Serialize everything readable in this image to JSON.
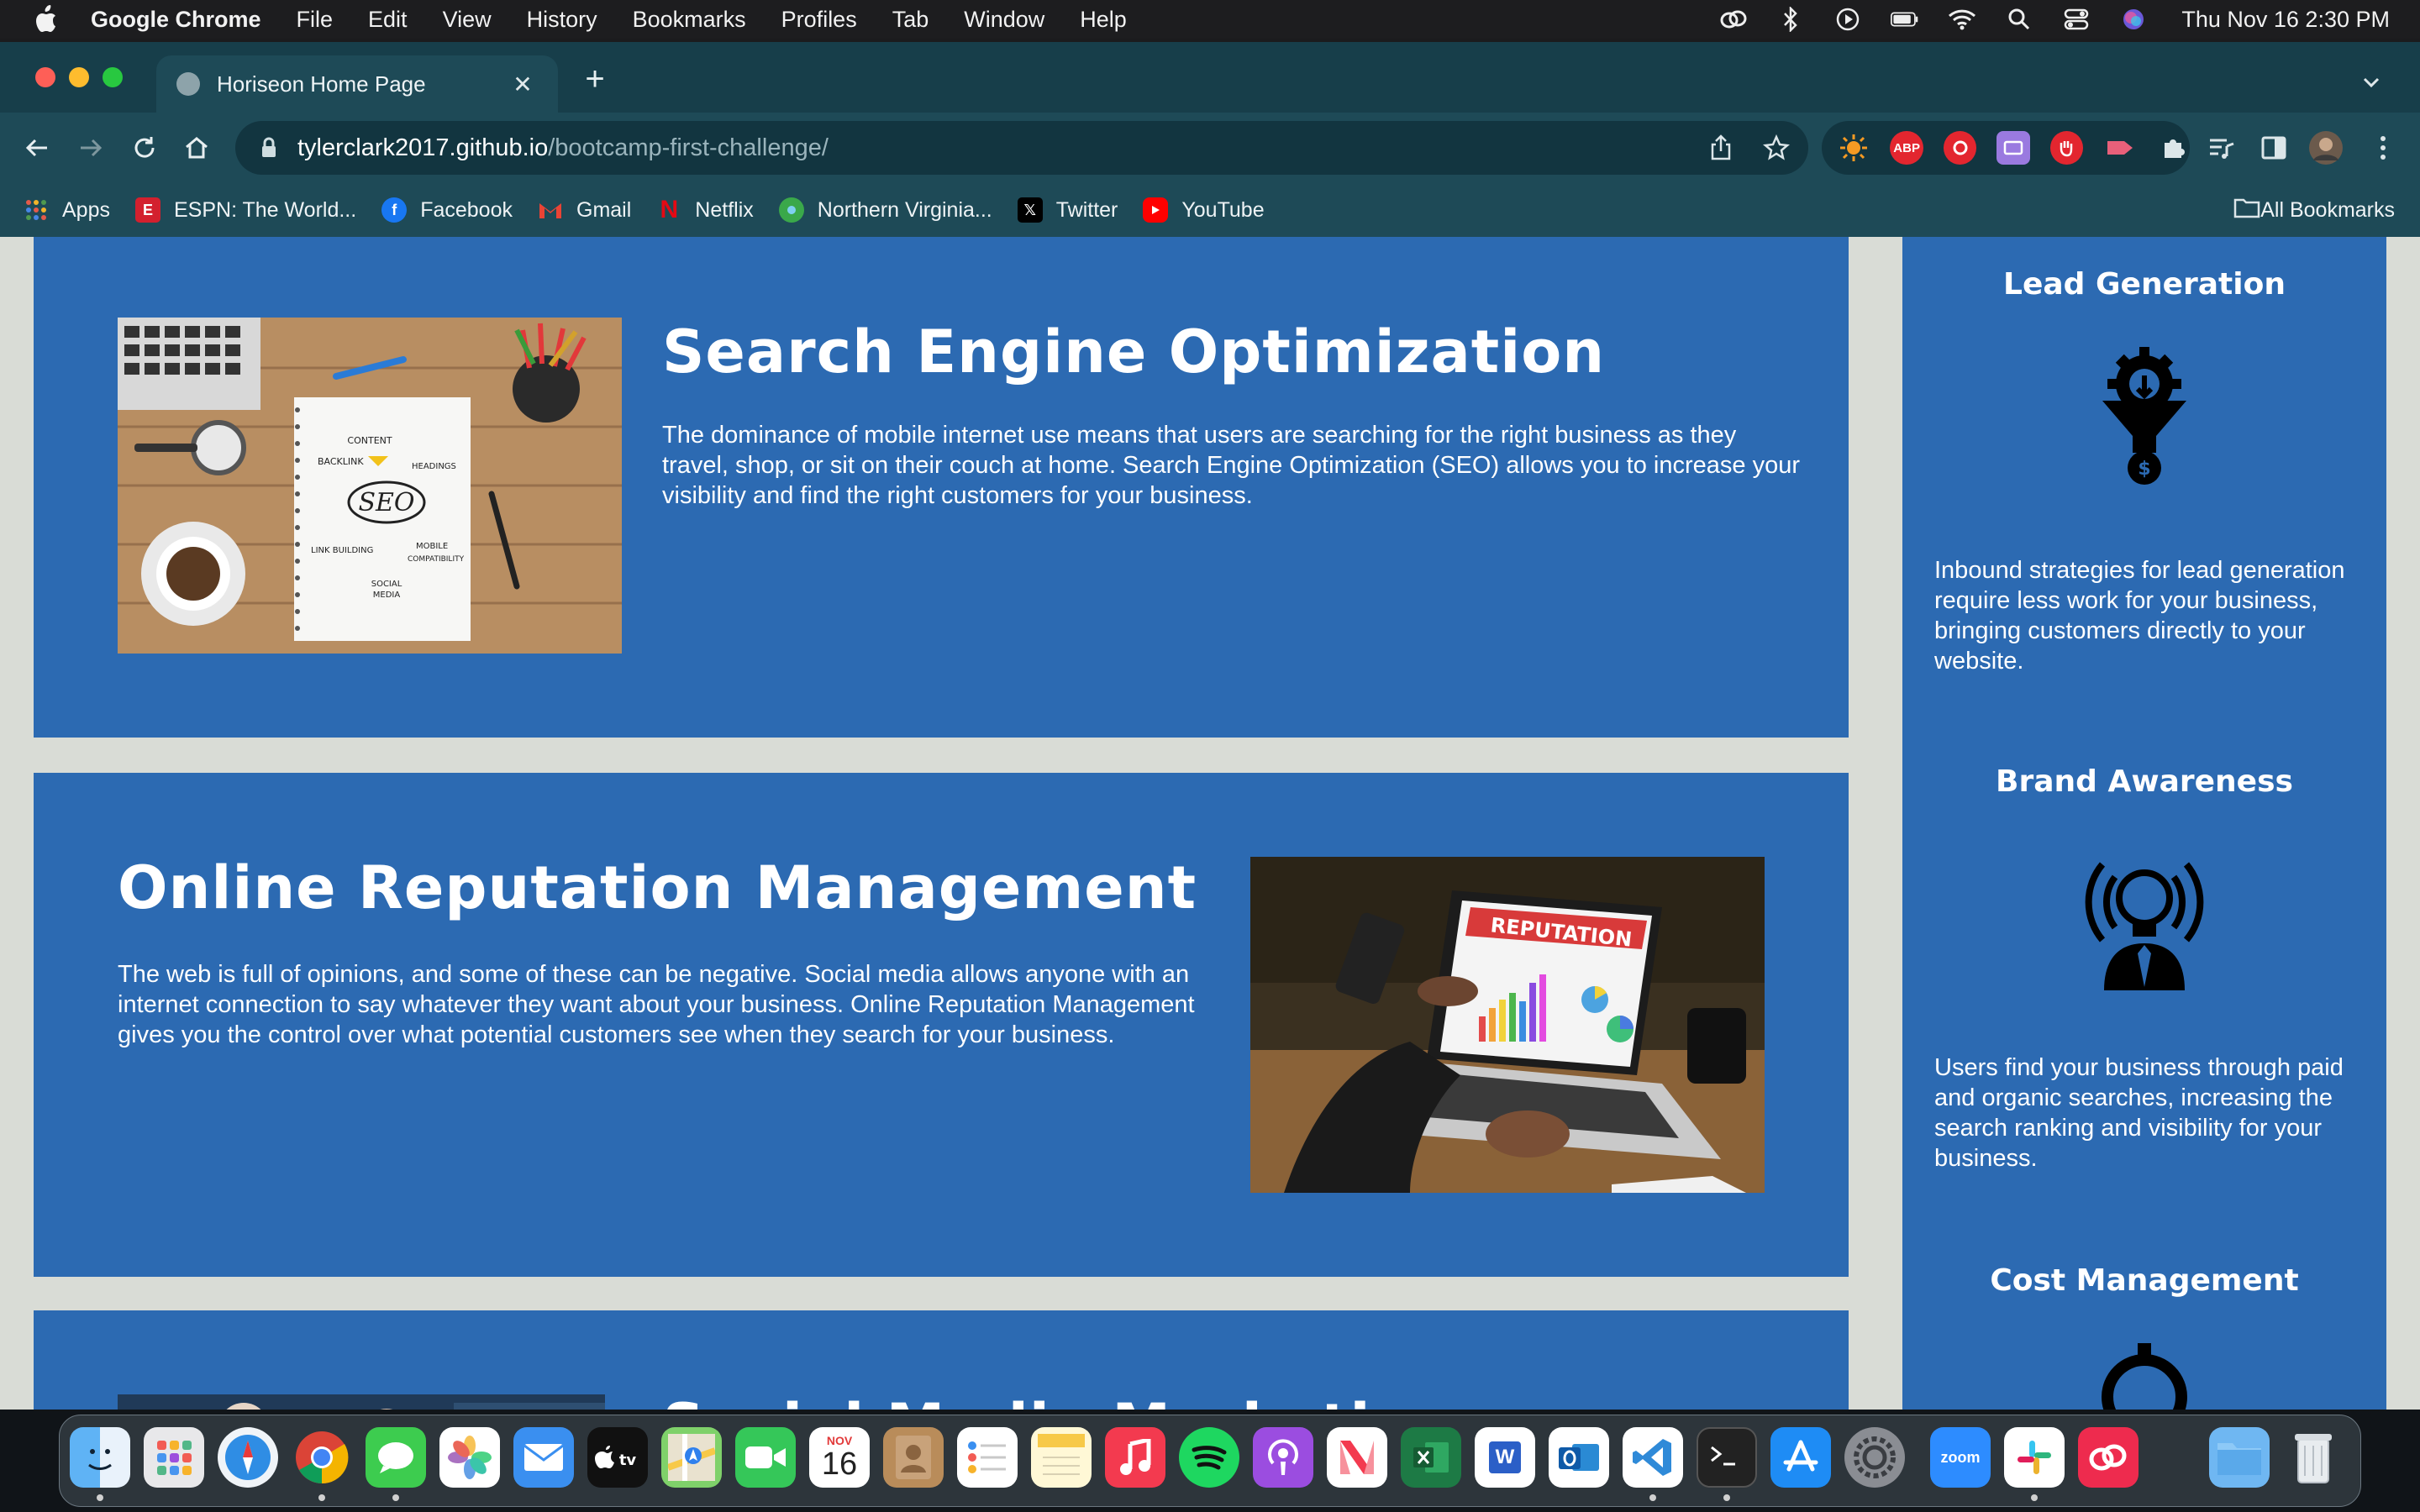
{
  "menubar": {
    "app_name": "Google Chrome",
    "items": [
      "File",
      "Edit",
      "View",
      "History",
      "Bookmarks",
      "Profiles",
      "Tab",
      "Window",
      "Help"
    ],
    "clock": "Thu Nov 16  2:30 PM"
  },
  "browser": {
    "tab_title": "Horiseon Home Page",
    "url_host": "tylerclark2017.github.io",
    "url_path": "/bootcamp-first-challenge/",
    "extensions": [
      "ABP"
    ],
    "bookmarks": [
      {
        "label": "Apps",
        "icon": "apps-grid-icon"
      },
      {
        "label": "ESPN: The World...",
        "icon": "espn-icon"
      },
      {
        "label": "Facebook",
        "icon": "facebook-icon"
      },
      {
        "label": "Gmail",
        "icon": "gmail-icon"
      },
      {
        "label": "Netflix",
        "icon": "netflix-icon"
      },
      {
        "label": "Northern Virginia...",
        "icon": "nova-icon"
      },
      {
        "label": "Twitter",
        "icon": "x-icon"
      },
      {
        "label": "YouTube",
        "icon": "youtube-icon"
      }
    ],
    "all_bookmarks": "All Bookmarks"
  },
  "content": {
    "seo": {
      "title": "Search Engine Optimization",
      "text": "The dominance of mobile internet use means that users are searching for the right business as they travel, shop, or sit on their couch at home. Search Engine Optimization (SEO) allows you to increase your visibility and find the right customers for your business.",
      "image_words": {
        "content": "CONTENT",
        "backlink": "BACKLINK",
        "headings": "HEADINGS",
        "seo": "SEO",
        "link_building": "LINK BUILDING",
        "mobile": "MOBILE",
        "compat": "COMPATIBILITY",
        "social": "SOCIAL",
        "media": "MEDIA"
      }
    },
    "orm": {
      "title": "Online Reputation Management",
      "text": "The web is full of opinions, and some of these can be negative. Social media allows anyone with an internet connection to say whatever they want about your business. Online Reputation Management gives you the control over what potential customers see when they search for your business.",
      "image_banner": "REPUTATION"
    },
    "smm": {
      "title": "Social Media Marketing"
    }
  },
  "benefits": [
    {
      "title": "Lead Generation",
      "icon": "lead-generation-funnel-icon",
      "text": "Inbound strategies for lead generation require less work for your business, bringing customers directly to your website."
    },
    {
      "title": "Brand Awareness",
      "icon": "brand-awareness-lightbulb-icon",
      "text": "Users find your business through paid and organic searches, increasing the search ranking and visibility for your business."
    },
    {
      "title": "Cost Management",
      "icon": "cost-management-gear-icon"
    }
  ],
  "dock": {
    "calendar_month": "NOV",
    "calendar_day": "16",
    "zoom_label": "zoom",
    "word_letter": "W"
  },
  "colors": {
    "card_blue": "#2c6ab2",
    "page_bg": "#d9dcd6",
    "chrome_toolbar": "#1e4a57",
    "chrome_tabstrip": "#173e4a"
  }
}
